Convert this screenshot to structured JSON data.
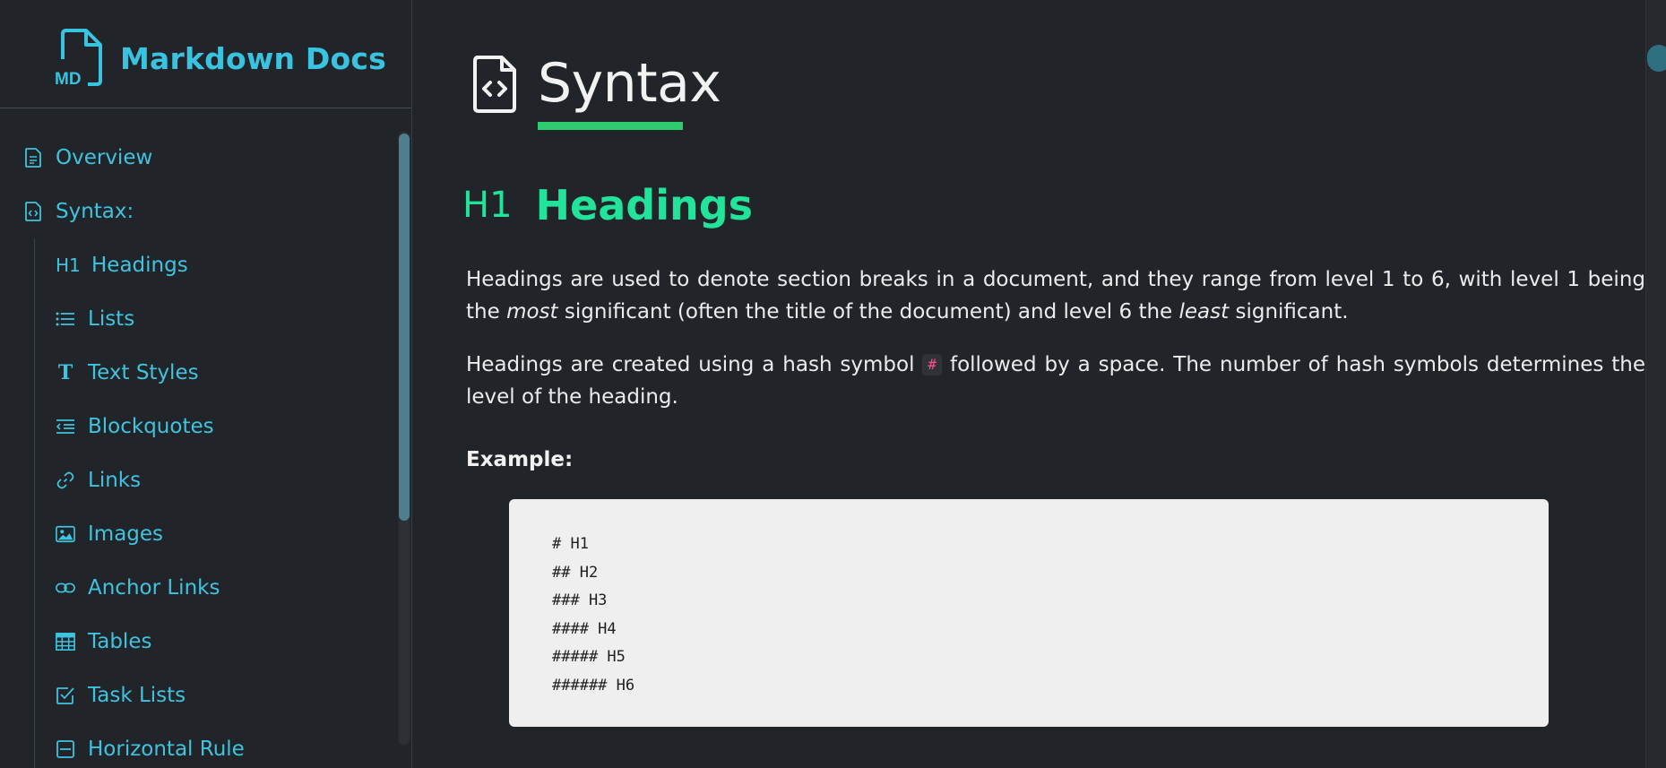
{
  "brand": {
    "logo_text": "MD",
    "title": "Markdown Docs",
    "accent": "#38c4e0"
  },
  "sidebar": {
    "items": [
      {
        "label": "Overview",
        "icon": "document-icon"
      },
      {
        "label": "Syntax:",
        "icon": "code-file-icon"
      }
    ],
    "sub_items": [
      {
        "label": "Headings",
        "icon": "h1-icon",
        "icon_text": "H1"
      },
      {
        "label": "Lists",
        "icon": "list-icon"
      },
      {
        "label": "Text Styles",
        "icon": "text-style-icon",
        "icon_text": "T"
      },
      {
        "label": "Blockquotes",
        "icon": "blockquote-icon"
      },
      {
        "label": "Links",
        "icon": "link-icon"
      },
      {
        "label": "Images",
        "icon": "image-icon"
      },
      {
        "label": "Anchor Links",
        "icon": "anchor-link-icon"
      },
      {
        "label": "Tables",
        "icon": "table-icon"
      },
      {
        "label": "Task Lists",
        "icon": "checkbox-icon"
      },
      {
        "label": "Horizontal Rule",
        "icon": "horizontal-rule-icon"
      }
    ]
  },
  "main": {
    "page_title": "Syntax",
    "section": {
      "badge": "H1",
      "title": "Headings"
    },
    "paragraph1": {
      "part1": "Headings are used to denote section breaks in a document, and they range from level 1 to 6, with level 1 being the ",
      "em1": "most",
      "part2": " significant (often the title of the document) and level 6 the ",
      "em2": "least",
      "part3": " significant."
    },
    "paragraph2": {
      "part1": "Headings are created using a hash symbol ",
      "code": "#",
      "part2": " followed by a space. The number of hash symbols determines the level of the heading."
    },
    "example_label": "Example:",
    "code_lines": [
      "# H1",
      "## H2",
      "### H3",
      "#### H4",
      "##### H5",
      "###### H6"
    ]
  },
  "colors": {
    "background": "#212429",
    "heading_green": "#22e39a",
    "underline_green": "#2ecb70",
    "inline_code": "#ff4e93",
    "code_bg": "#efefef"
  }
}
